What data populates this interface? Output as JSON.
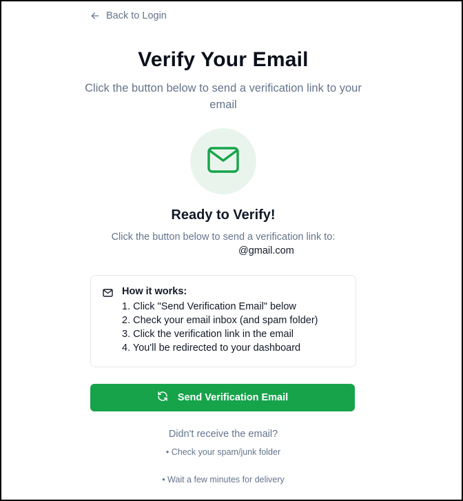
{
  "nav": {
    "back_label": "Back to Login"
  },
  "header": {
    "title": "Verify Your Email",
    "subtitle": "Click the button below to send a verification link to your email"
  },
  "status": {
    "heading": "Ready to Verify!",
    "send_to_text": "Click the button below to send a verification link to:",
    "email_visible": "@gmail.com"
  },
  "how_it_works": {
    "heading": "How it works:",
    "steps": [
      "1. Click \"Send Verification Email\" below",
      "2. Check your email inbox (and spam folder)",
      "3. Click the verification link in the email",
      "4. You'll be redirected to your dashboard"
    ]
  },
  "actions": {
    "send_label": "Send Verification Email"
  },
  "help": {
    "question": "Didn't receive the email?",
    "tips": [
      "• Check your spam/junk folder",
      "• Wait a few minutes for delivery"
    ]
  },
  "colors": {
    "accent": "#16a34a",
    "icon_bg": "#e9f5ec",
    "muted_text": "#64748b",
    "heading_text": "#0b0f1a"
  },
  "icons": {
    "back": "arrow-left-icon",
    "hero": "mail-icon",
    "box": "mail-icon",
    "button": "refresh-icon"
  }
}
